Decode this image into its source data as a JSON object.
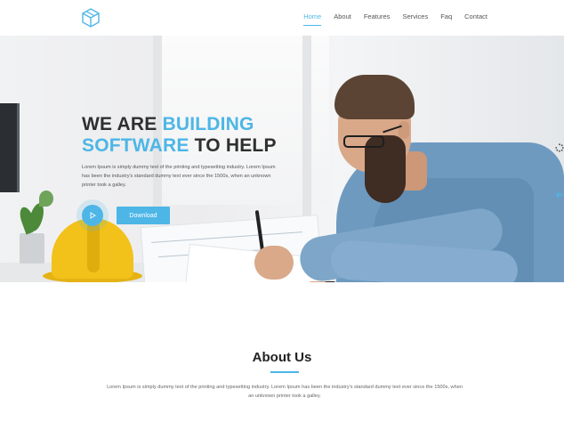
{
  "nav": {
    "items": [
      {
        "label": "Home",
        "active": true
      },
      {
        "label": "About"
      },
      {
        "label": "Features"
      },
      {
        "label": "Services"
      },
      {
        "label": "Faq"
      },
      {
        "label": "Contact"
      }
    ]
  },
  "hero": {
    "title_line1_plain": "WE ARE ",
    "title_line1_accent": "BUILDING",
    "title_line2_accent": "SOFTWARE",
    "title_line2_plain": " TO HELP",
    "description": "Lorem Ipsum is simply dummy text of the printing and typesetting industry. Lorem Ipsum has been the industry's standard dummy text ever since the 1500s, when an unknown printer took a galley.",
    "download_label": "Download"
  },
  "about": {
    "title": "About Us",
    "text": "Lorem Ipsum is simply dummy text of the printing and typesetting industry. Lorem Ipsum has been the industry's standard dummy text ever since the 1500s, when an unknown printer took a galley."
  },
  "colors": {
    "accent": "#4db6e6",
    "heading": "#2f2f2f"
  },
  "icons": {
    "logo": "cube-logo-icon",
    "play": "play-icon",
    "loader": "loader-icon",
    "arrow": "arrow-left-icon"
  }
}
